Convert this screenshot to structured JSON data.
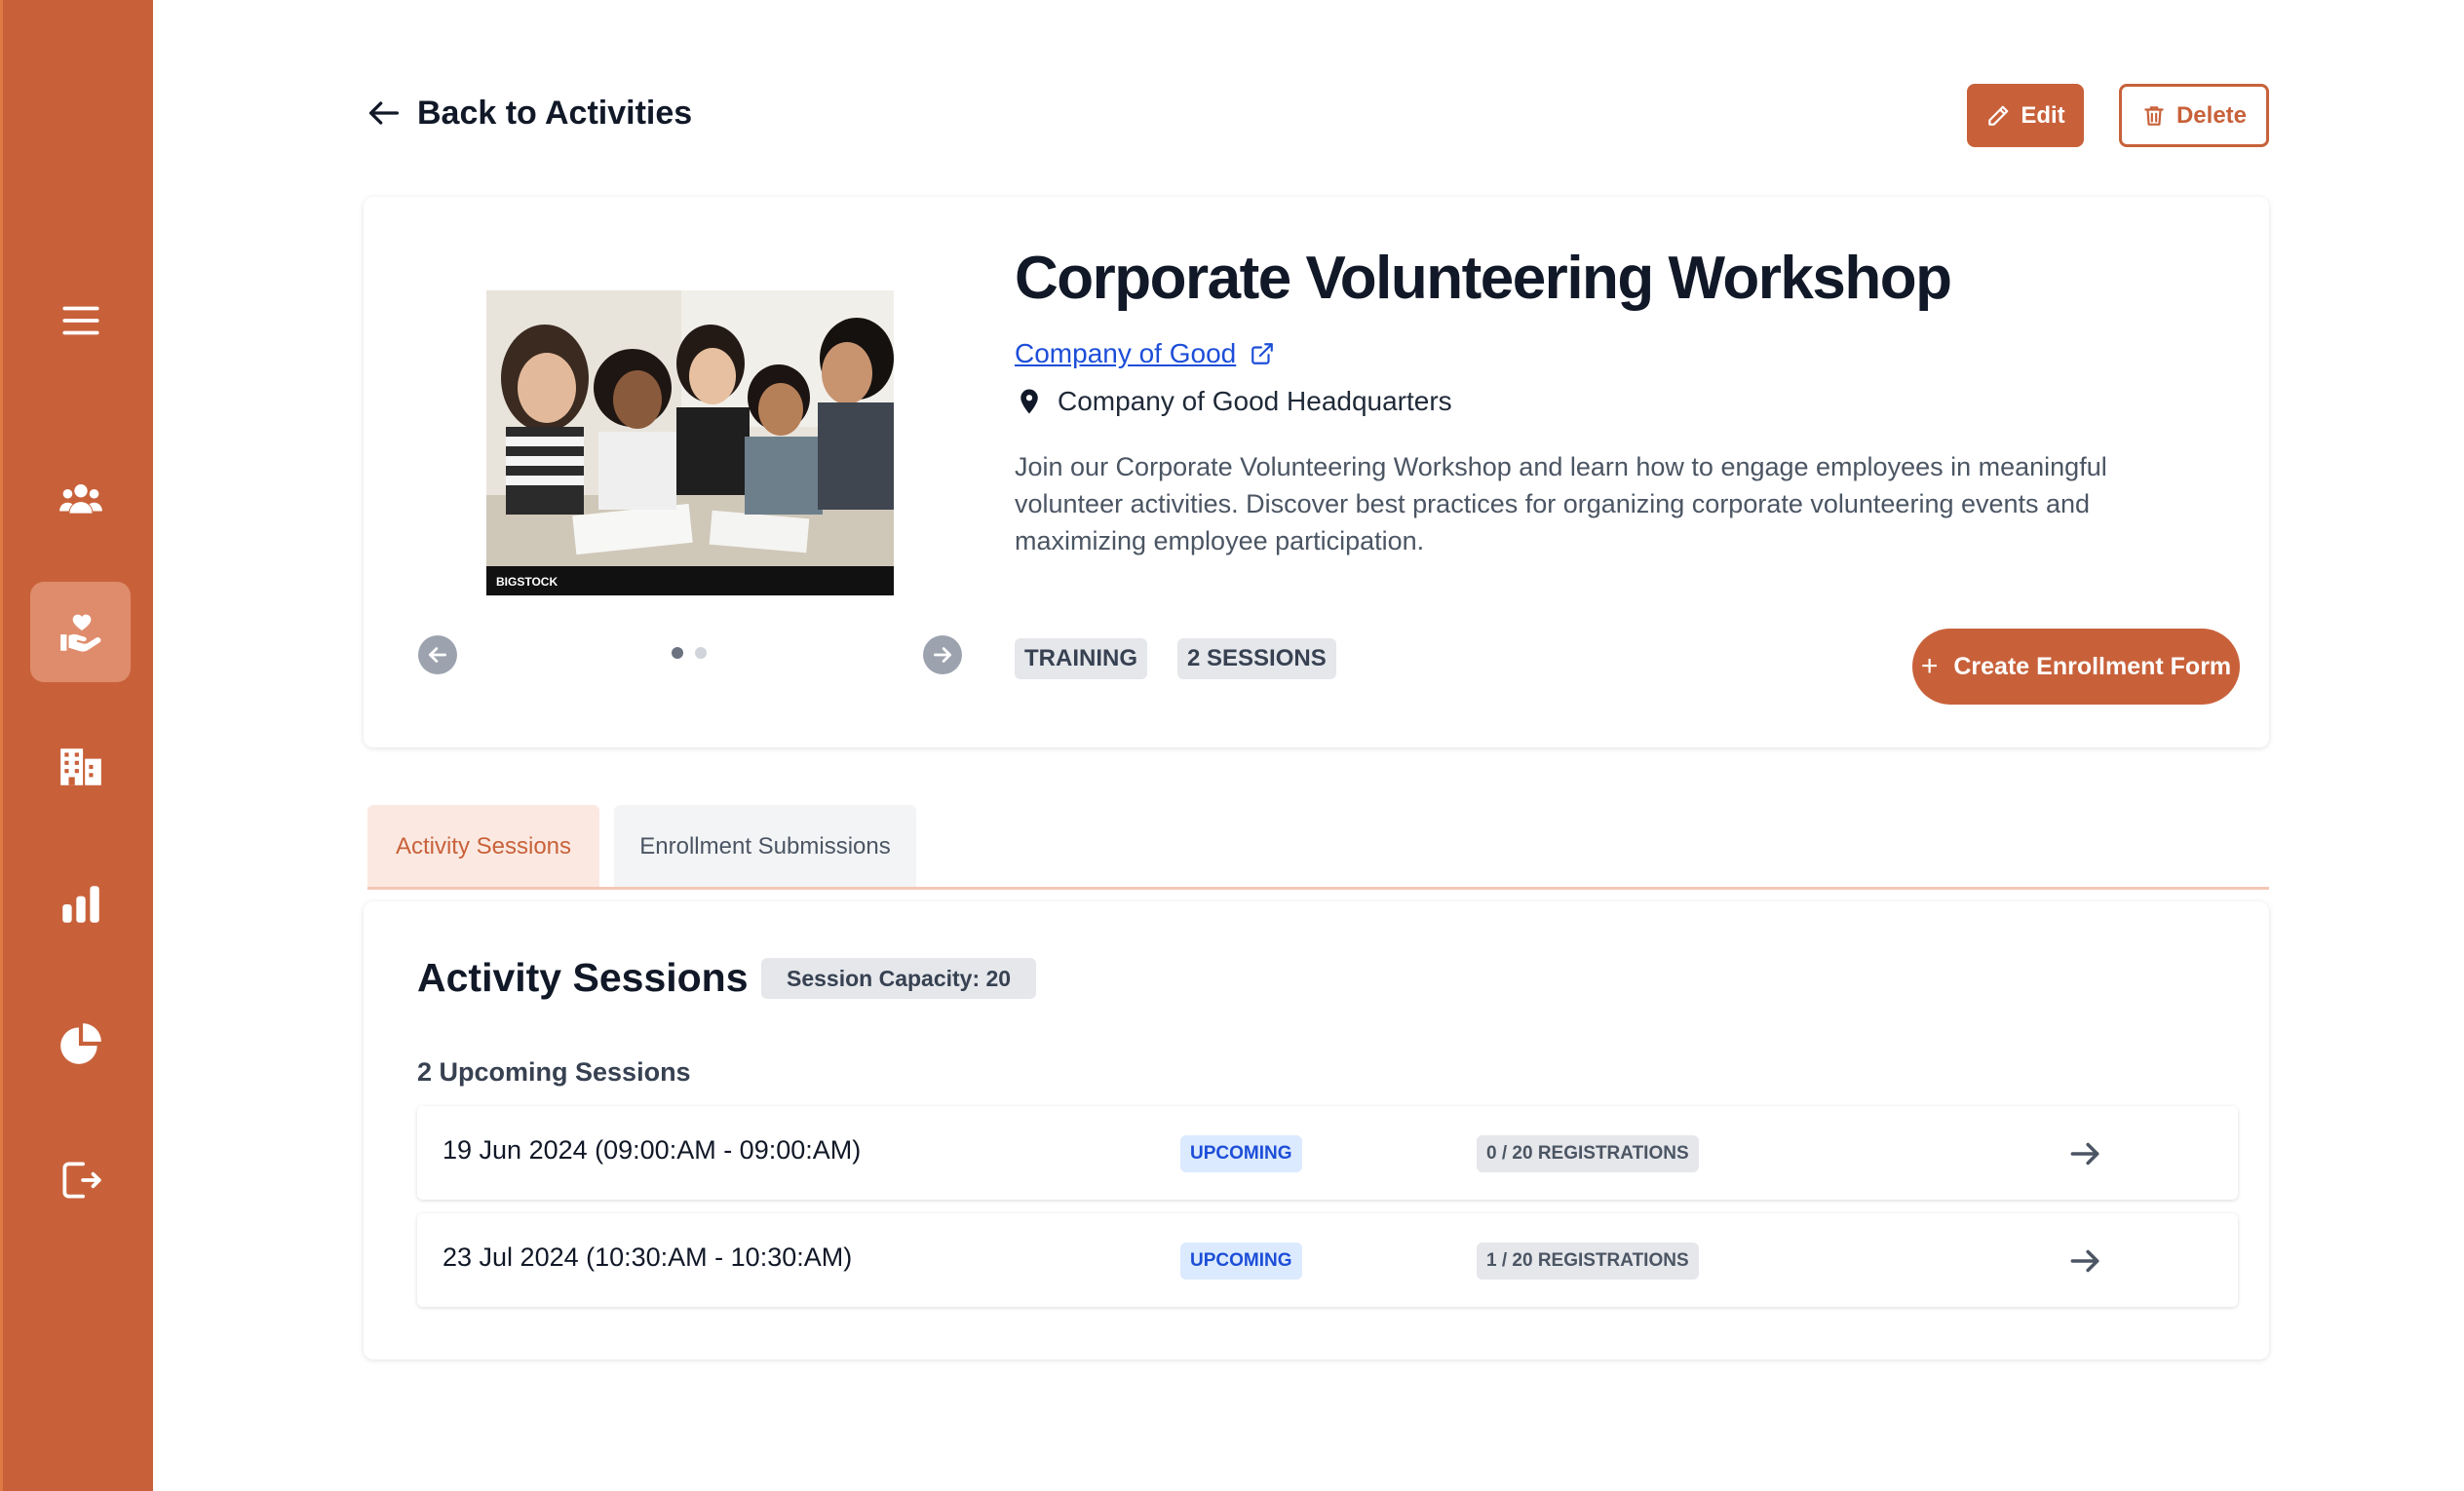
{
  "nav": {
    "back_label": "Back to Activities",
    "edit_label": "Edit",
    "delete_label": "Delete"
  },
  "sidebar": {
    "items": [
      {
        "icon": "menu-icon",
        "active": false
      },
      {
        "icon": "users-icon",
        "active": false
      },
      {
        "icon": "volunteer-hand-heart-icon",
        "active": true
      },
      {
        "icon": "building-icon",
        "active": false
      },
      {
        "icon": "bar-chart-icon",
        "active": false
      },
      {
        "icon": "pie-chart-icon",
        "active": false
      },
      {
        "icon": "logout-icon",
        "active": false
      }
    ]
  },
  "activity": {
    "title": "Corporate Volunteering Workshop",
    "company": "Company of Good",
    "location": "Company of Good Headquarters",
    "description": "Join our Corporate Volunteering Workshop and learn how to engage employees in meaningful volunteer activities. Discover best practices for organizing corporate volunteering events and maximizing employee participation.",
    "tags": [
      "TRAINING",
      "2 SESSIONS"
    ],
    "enroll_button": "Create Enrollment Form",
    "image_watermark": "BIGSTOCK",
    "carousel": {
      "current": 1,
      "total": 2
    }
  },
  "tabs": [
    {
      "label": "Activity Sessions",
      "active": true
    },
    {
      "label": "Enrollment Submissions",
      "active": false
    }
  ],
  "sessions": {
    "title": "Activity Sessions",
    "capacity_label": "Session Capacity: 20",
    "upcoming_label": "2 Upcoming Sessions",
    "rows": [
      {
        "date": "19 Jun 2024 (09:00:AM - 09:00:AM)",
        "status": "UPCOMING",
        "registrations": "0 / 20 REGISTRATIONS"
      },
      {
        "date": "23 Jul 2024 (10:30:AM - 10:30:AM)",
        "status": "UPCOMING",
        "registrations": "1 / 20 REGISTRATIONS"
      }
    ]
  },
  "colors": {
    "brand": "#c8613a",
    "sidebar_active": "#df8c6c",
    "link": "#1d4ed8",
    "status_bg": "#dbeafe"
  }
}
